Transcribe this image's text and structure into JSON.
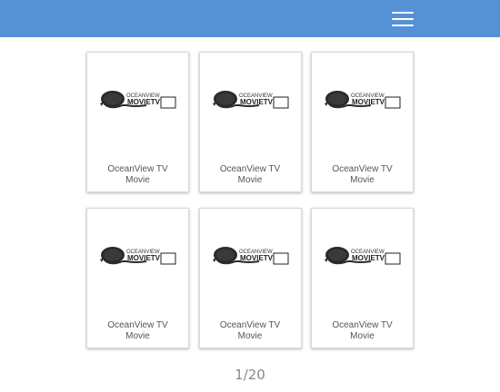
{
  "header": {
    "menu_icon": "hamburger-menu-icon",
    "background": "#5691d6"
  },
  "logo": {
    "line1": "OCEANVIEW",
    "line2": "MOVIETV"
  },
  "grid": {
    "items": [
      {
        "title_line1": "OceanView TV",
        "title_line2": "Movie"
      },
      {
        "title_line1": "OceanView TV",
        "title_line2": "Movie"
      },
      {
        "title_line1": "OceanView TV",
        "title_line2": "Movie"
      },
      {
        "title_line1": "OceanView TV",
        "title_line2": "Movie"
      },
      {
        "title_line1": "OceanView TV",
        "title_line2": "Movie"
      },
      {
        "title_line1": "OceanView TV",
        "title_line2": "Movie"
      }
    ]
  },
  "pager": {
    "text": "1/20"
  }
}
